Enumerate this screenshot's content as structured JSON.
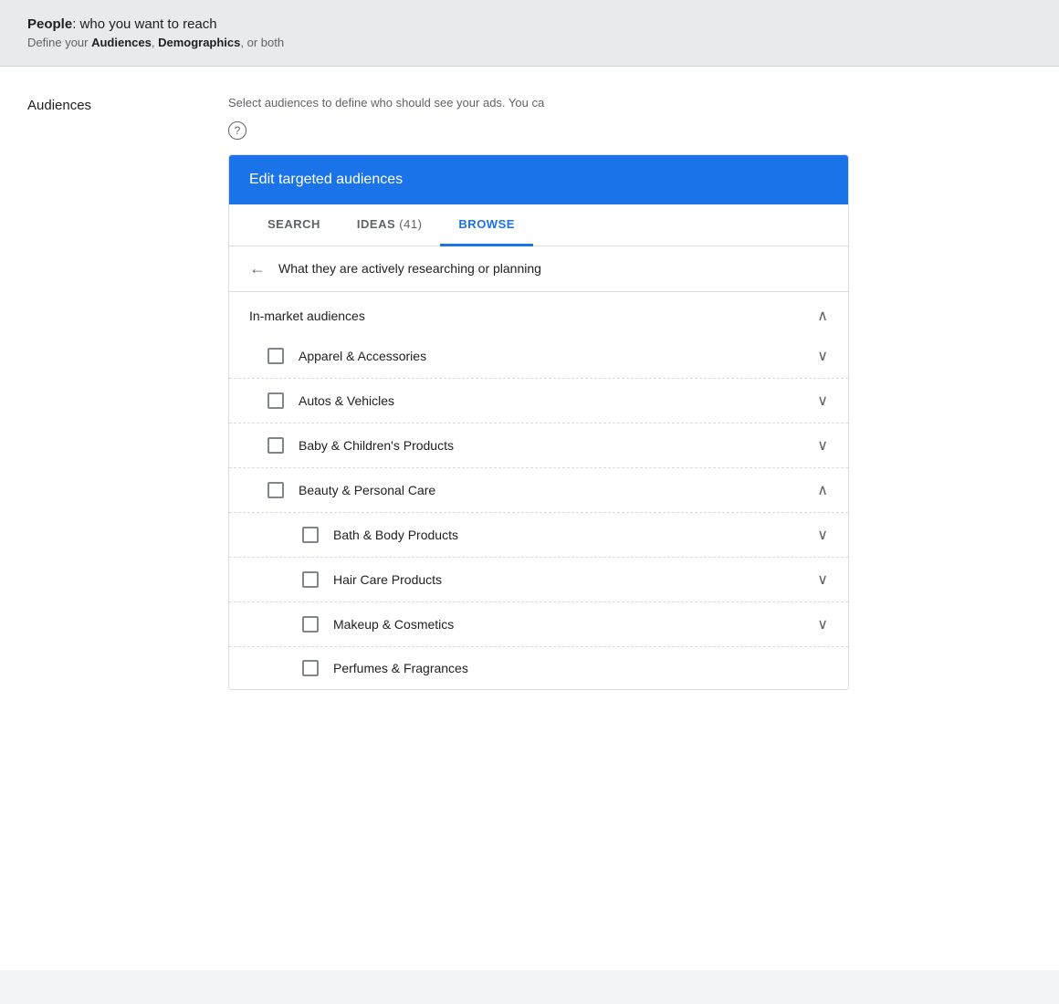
{
  "top_banner": {
    "title_prefix": "People",
    "title_suffix": ": who you want to reach",
    "subtitle_prefix": "Define your ",
    "subtitle_audiences": "Audiences",
    "subtitle_comma": ", ",
    "subtitle_demographics": "Demographics",
    "subtitle_suffix": ", or both"
  },
  "left": {
    "audiences_label": "Audiences"
  },
  "description": {
    "text": "Select audiences to define who should see your ads.  You ca",
    "help_icon": "?"
  },
  "audiences_box": {
    "header_title": "Edit targeted audiences",
    "tabs": [
      {
        "id": "search",
        "label": "SEARCH",
        "count": null,
        "active": false
      },
      {
        "id": "ideas",
        "label": "IDEAS",
        "count": "41",
        "active": false
      },
      {
        "id": "browse",
        "label": "BROWSE",
        "count": null,
        "active": true
      }
    ],
    "back_text": "What they are actively researching or planning",
    "section_title": "In-market audiences",
    "section_expanded": true,
    "list_items": [
      {
        "id": "apparel",
        "label": "Apparel & Accessories",
        "checked": false,
        "expanded": false,
        "sub_items": []
      },
      {
        "id": "autos",
        "label": "Autos & Vehicles",
        "checked": false,
        "expanded": false,
        "sub_items": []
      },
      {
        "id": "baby",
        "label": "Baby & Children's Products",
        "checked": false,
        "expanded": false,
        "sub_items": []
      },
      {
        "id": "beauty",
        "label": "Beauty & Personal Care",
        "checked": false,
        "expanded": true,
        "sub_items": [
          {
            "id": "bath",
            "label": "Bath & Body Products",
            "checked": false,
            "expanded": false
          },
          {
            "id": "hair",
            "label": "Hair Care Products",
            "checked": false,
            "expanded": false
          },
          {
            "id": "makeup",
            "label": "Makeup & Cosmetics",
            "checked": false,
            "expanded": false
          },
          {
            "id": "perfumes",
            "label": "Perfumes & Fragrances",
            "checked": false,
            "expanded": false
          }
        ]
      }
    ],
    "chevron_up": "∧",
    "chevron_down": "∨",
    "back_arrow": "←"
  }
}
